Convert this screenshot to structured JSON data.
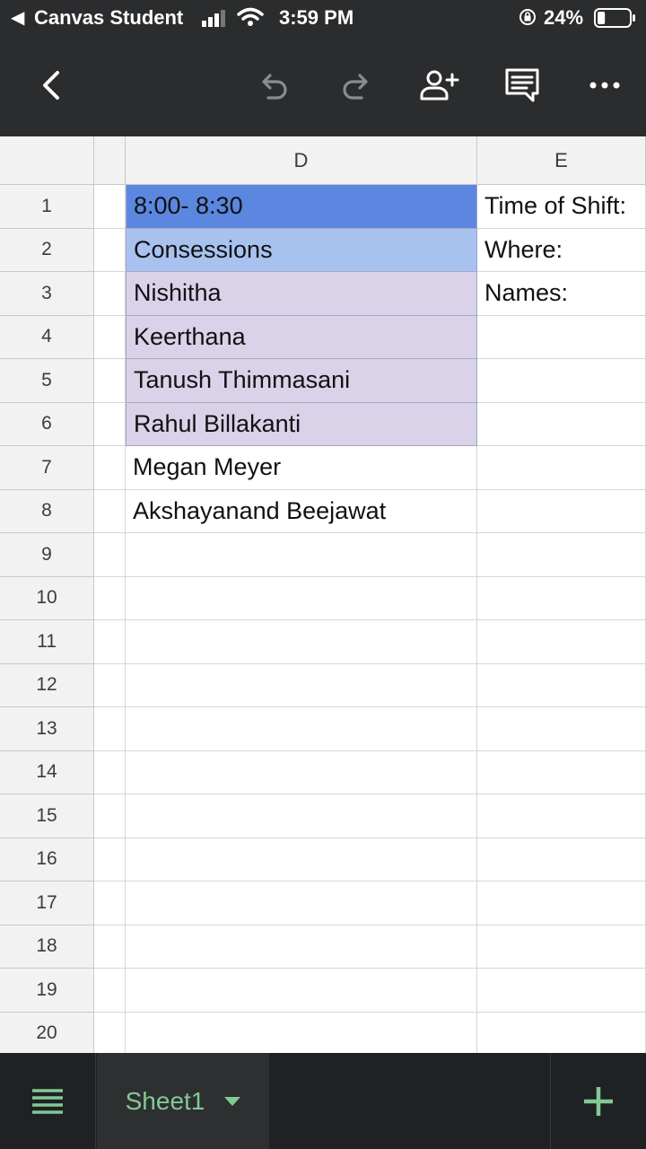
{
  "status_bar": {
    "back_glyph": "◀",
    "app_name": "Canvas Student",
    "time": "3:59 PM",
    "battery_percent": "24%",
    "battery_level": 0.24,
    "icons": [
      "signal-icon",
      "wifi-icon",
      "rotation-lock-icon",
      "battery-icon"
    ]
  },
  "toolbar": {
    "buttons": [
      "back-icon",
      "undo-icon",
      "redo-icon",
      "share-add-person-icon",
      "comment-icon",
      "more-icon"
    ]
  },
  "sheet": {
    "columns": [
      {
        "label": ""
      },
      {
        "label": "D"
      },
      {
        "label": "E"
      }
    ],
    "rows": [
      {
        "num": "1",
        "d": "8:00- 8:30",
        "e": "Time of Shift:"
      },
      {
        "num": "2",
        "d": "Consessions",
        "e": "Where:"
      },
      {
        "num": "3",
        "d": "Nishitha",
        "e": "Names:"
      },
      {
        "num": "4",
        "d": "Keerthana",
        "e": ""
      },
      {
        "num": "5",
        "d": "Tanush Thimmasani",
        "e": ""
      },
      {
        "num": "6",
        "d": "Rahul Billakanti",
        "e": ""
      },
      {
        "num": "7",
        "d": "Megan Meyer",
        "e": ""
      },
      {
        "num": "8",
        "d": "Akshayanand Beejawat",
        "e": ""
      },
      {
        "num": "9",
        "d": "",
        "e": ""
      },
      {
        "num": "10",
        "d": "",
        "e": ""
      },
      {
        "num": "11",
        "d": "",
        "e": ""
      },
      {
        "num": "12",
        "d": "",
        "e": ""
      },
      {
        "num": "13",
        "d": "",
        "e": ""
      },
      {
        "num": "14",
        "d": "",
        "e": ""
      },
      {
        "num": "15",
        "d": "",
        "e": ""
      },
      {
        "num": "16",
        "d": "",
        "e": ""
      },
      {
        "num": "17",
        "d": "",
        "e": ""
      },
      {
        "num": "18",
        "d": "",
        "e": ""
      },
      {
        "num": "19",
        "d": "",
        "e": ""
      },
      {
        "num": "20",
        "d": "",
        "e": ""
      }
    ],
    "fills": {
      "header_blue": "#5b87e0",
      "light_blue": "#a8c2f0",
      "lavender": "#d9d2e9"
    }
  },
  "bottom_bar": {
    "sheet_tab_label": "Sheet1",
    "accent_color": "#81c995",
    "icons": [
      "all-sheets-icon",
      "dropdown-arrow-icon",
      "add-sheet-icon"
    ]
  }
}
